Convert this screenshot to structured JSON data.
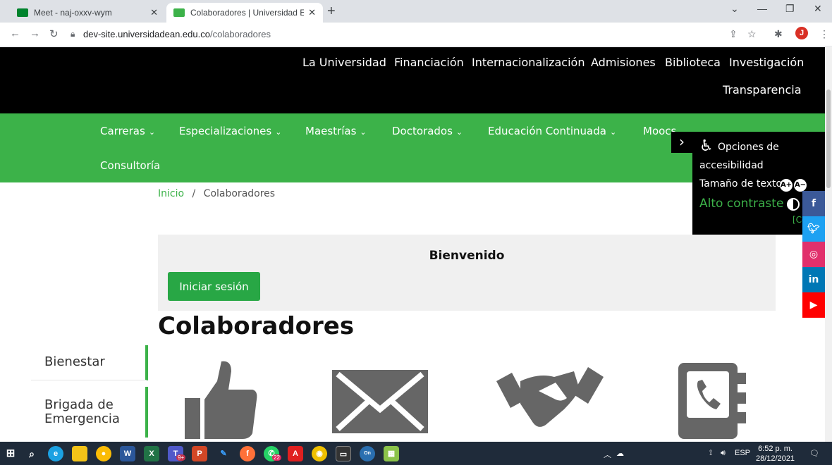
{
  "browser": {
    "tabs": [
      {
        "title": "Meet - naj-oxxv-wym",
        "active": false,
        "favicon_color": "#f9ab00"
      },
      {
        "title": "Colaboradores | Universidad Ean",
        "active": true,
        "favicon_color": "#3cb249"
      }
    ],
    "url_host": "dev-site.universidadean.edu.co",
    "url_path": "/colaboradores",
    "profile_initial": "J"
  },
  "topnav": {
    "links": [
      "La Universidad",
      "Financiación",
      "Internacionalización",
      "Admisiones",
      "Biblioteca",
      "Investigación",
      "Transparencia"
    ]
  },
  "mainnav": {
    "items": [
      {
        "label": "Carreras",
        "chevron": true
      },
      {
        "label": "Especializaciones",
        "chevron": true
      },
      {
        "label": "Maestrías",
        "chevron": true
      },
      {
        "label": "Doctorados",
        "chevron": true
      },
      {
        "label": "Educación Continuada",
        "chevron": true
      },
      {
        "label": "Moocs",
        "chevron": true
      },
      {
        "label": "Consultoría",
        "chevron": false
      }
    ]
  },
  "breadcrumb": {
    "home": "Inicio",
    "separator": "/",
    "current": "Colaboradores"
  },
  "welcome": {
    "title": "Bienvenido",
    "login_button": "Iniciar sesión"
  },
  "page_title": "Colaboradores",
  "sidebar": {
    "items": [
      "Bienestar",
      "Brigada de Emergencia"
    ]
  },
  "feature_icons": [
    "thumbs-up-icon",
    "envelope-icon",
    "handshake-icon",
    "phone-book-icon"
  ],
  "accessibility": {
    "title_line1": "Opciones de",
    "title_line2": "accesibilidad",
    "text_size_label": "Tamaño de texto",
    "increase": "A+",
    "decrease": "A−",
    "contrast_label": "Alto contraste",
    "close_label": "[Ce"
  },
  "social": [
    {
      "name": "facebook",
      "glyph": "f",
      "color": "#3b5998"
    },
    {
      "name": "twitter",
      "glyph": "t",
      "color": "#1da1f2"
    },
    {
      "name": "instagram",
      "glyph": "◎",
      "color": "#e1306c"
    },
    {
      "name": "linkedin",
      "glyph": "in",
      "color": "#0077b5"
    },
    {
      "name": "youtube",
      "glyph": "▶",
      "color": "#ff0000"
    }
  ],
  "taskbar": {
    "language": "ESP",
    "time": "6:52 p. m.",
    "date": "28/12/2021",
    "whatsapp_badge": "22",
    "teams_badge": "9+"
  },
  "colors": {
    "brand_green": "#3cb249",
    "header_black": "#000000"
  }
}
